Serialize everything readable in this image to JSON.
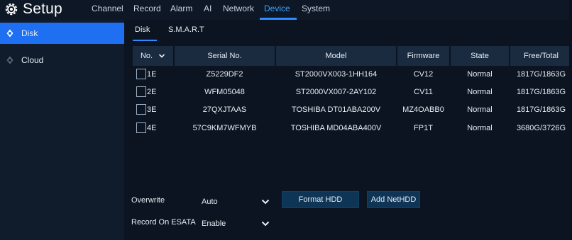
{
  "header": {
    "title": "Setup",
    "nav": [
      "Channel",
      "Record",
      "Alarm",
      "AI",
      "Network",
      "Device",
      "System"
    ],
    "active_nav": "Device"
  },
  "sidebar": {
    "items": [
      {
        "label": "Disk",
        "icon": "disk-icon",
        "active": true
      },
      {
        "label": "Cloud",
        "icon": "cloud-icon",
        "active": false
      }
    ]
  },
  "subtabs": [
    "Disk",
    "S.M.A.R.T"
  ],
  "table": {
    "columns": [
      "No.",
      "Serial No.",
      "Model",
      "Firmware",
      "State",
      "Free/Total"
    ],
    "rows": [
      {
        "no": "1E",
        "serial": "Z5229DF2",
        "model": "ST2000VX003-1HH164",
        "firmware": "CV12",
        "state": "Normal",
        "free_total": "1817G/1863G"
      },
      {
        "no": "2E",
        "serial": "WFM05048",
        "model": "ST2000VX007-2AY102",
        "firmware": "CV11",
        "state": "Normal",
        "free_total": "1817G/1863G"
      },
      {
        "no": "3E",
        "serial": "27QXJTAAS",
        "model": "TOSHIBA DT01ABA200V",
        "firmware": "MZ4OABB0",
        "state": "Normal",
        "free_total": "1817G/1863G"
      },
      {
        "no": "4E",
        "serial": "57C9KM7WFMYB",
        "model": "TOSHIBA MD04ABA400V",
        "firmware": "FP1T",
        "state": "Normal",
        "free_total": "3680G/3726G"
      }
    ]
  },
  "controls": {
    "overwrite_label": "Overwrite",
    "overwrite_value": "Auto",
    "esata_label": "Record On ESATA",
    "esata_value": "Enable",
    "format_button": "Format HDD",
    "add_button": "Add NetHDD"
  },
  "colors": {
    "accent": "#2f8bff",
    "active_side": "#1f6ff2"
  }
}
